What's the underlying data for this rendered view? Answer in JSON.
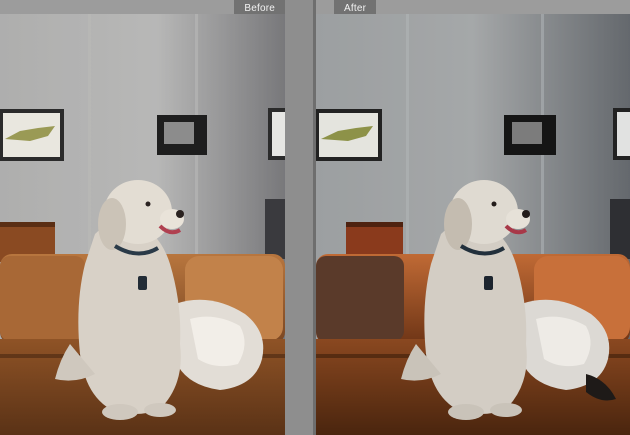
{
  "panes": {
    "before": {
      "label": "Before"
    },
    "after": {
      "label": "After"
    }
  },
  "colors": {
    "chrome": "#8f8f8f",
    "label_bg": "#727272",
    "sofa_before": "#b8763e",
    "sofa_after": "#c06a35"
  }
}
